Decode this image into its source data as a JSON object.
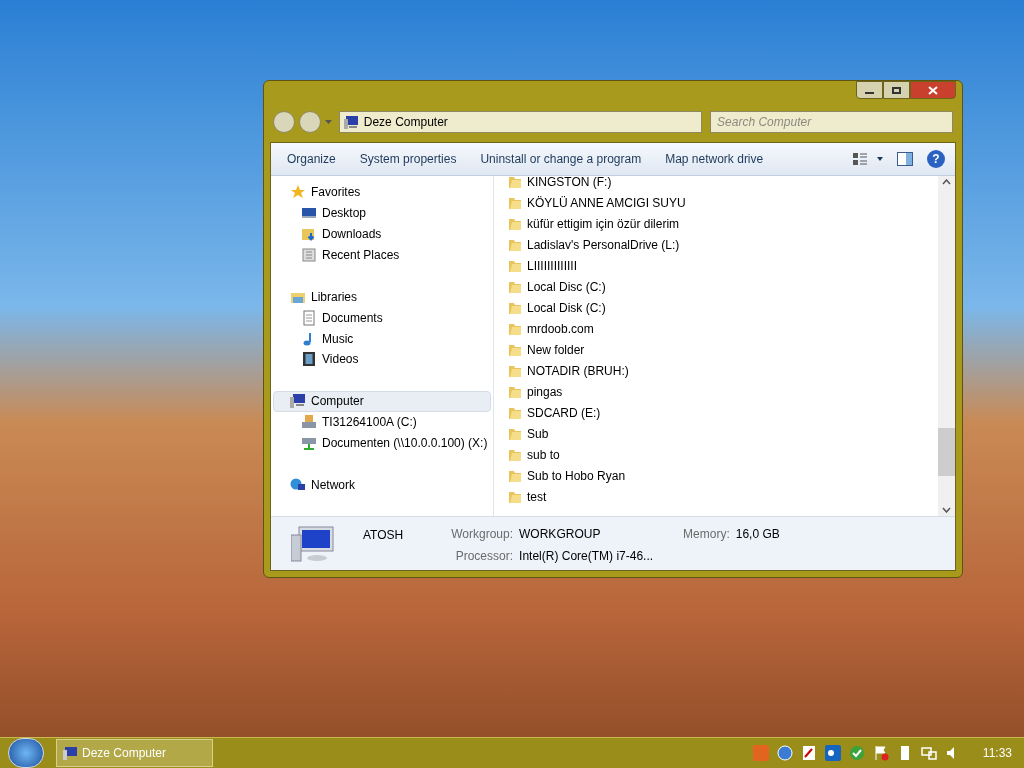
{
  "address_bar": {
    "location": "Deze Computer"
  },
  "search": {
    "placeholder": "Search Computer"
  },
  "help_button": "?",
  "toolbar": [
    "Organize",
    "System properties",
    "Uninstall or change a program",
    "Map network drive"
  ],
  "navigation": [
    {
      "label": "Favorites",
      "kind": "star",
      "selected": false,
      "children": [
        {
          "label": "Desktop",
          "kind": "desktop",
          "selected": false
        },
        {
          "label": "Downloads",
          "kind": "download",
          "selected": false
        },
        {
          "label": "Recent Places",
          "kind": "recent",
          "selected": false
        }
      ]
    },
    {
      "label": "Libraries",
      "kind": "library",
      "selected": false,
      "children": [
        {
          "label": "Documents",
          "kind": "document",
          "selected": false
        },
        {
          "label": "Music",
          "kind": "music",
          "selected": false
        },
        {
          "label": "Videos",
          "kind": "video",
          "selected": false
        }
      ]
    },
    {
      "label": "Computer",
      "kind": "computer",
      "selected": true,
      "children": [
        {
          "label": "TI31264100A (C:)",
          "kind": "drive",
          "selected": false
        },
        {
          "label": "Documenten (\\\\10.0.0.100) (X:)",
          "kind": "netdrive",
          "selected": false
        }
      ]
    },
    {
      "label": "Network",
      "kind": "network",
      "selected": false
    }
  ],
  "files": [
    "KINGSTON (F:)",
    "KÖYLÜ ANNE AMCIGI SUYU",
    "küfür ettigim için özür dilerim",
    "Ladislav's PersonalDrive (L:)",
    "LIIIIIIIIIIIII",
    "Local Disc (C:)",
    "Local Disk (C:)",
    "mrdoob.com",
    "New folder",
    "NOTADIR (BRUH:)",
    "pingas",
    "SDCARD (E:)",
    "Sub",
    "sub to",
    "Sub to Hobo Ryan",
    "test"
  ],
  "details": {
    "name": "ATOSH",
    "fields": [
      {
        "label": "Workgroup:",
        "value": "WORKGROUP"
      },
      {
        "label": "Memory:",
        "value": "16,0 GB"
      },
      {
        "label": "Processor:",
        "value": "Intel(R) Core(TM) i7-46..."
      }
    ]
  },
  "taskbar": {
    "task": "Deze Computer",
    "clock": "11:33"
  }
}
